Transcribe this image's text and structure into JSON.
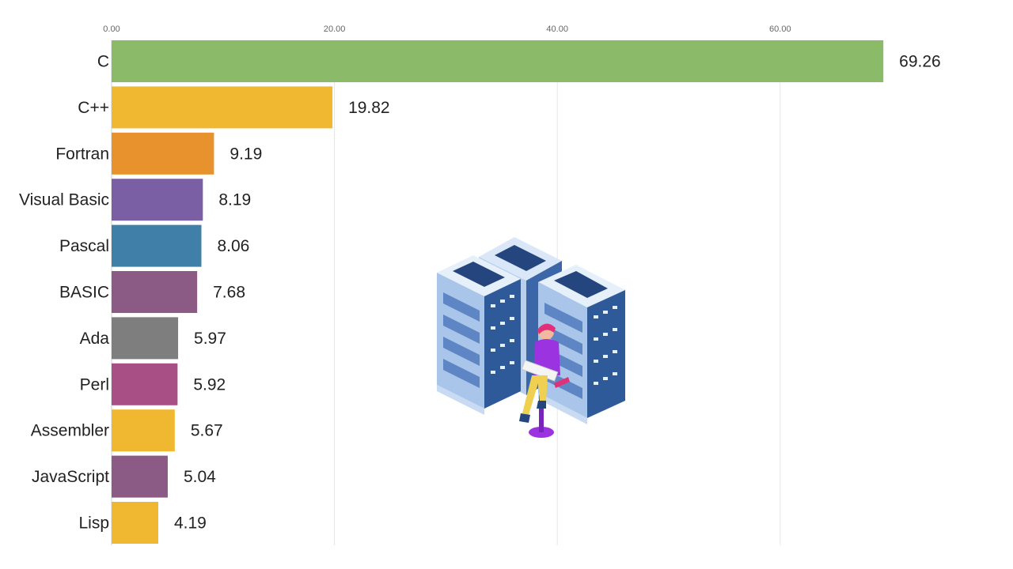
{
  "chart_data": {
    "type": "bar",
    "orientation": "horizontal",
    "categories": [
      "C",
      "C++",
      "Fortran",
      "Visual Basic",
      "Pascal",
      "BASIC",
      "Ada",
      "Perl",
      "Assembler",
      "JavaScript",
      "Lisp"
    ],
    "values": [
      69.26,
      19.82,
      9.19,
      8.19,
      8.06,
      7.68,
      5.97,
      5.92,
      5.67,
      5.04,
      4.19
    ],
    "value_labels": [
      "69.26",
      "19.82",
      "9.19",
      "8.19",
      "8.06",
      "7.68",
      "5.97",
      "5.92",
      "5.67",
      "5.04",
      "4.19"
    ],
    "colors": [
      "#8bbb68",
      "#f0b830",
      "#e8922e",
      "#7a5fa4",
      "#3f7fa8",
      "#8b5a85",
      "#7e7e7e",
      "#a84f85",
      "#f0b830",
      "#8b5a85",
      "#f0b830"
    ],
    "x_ticks": [
      0,
      20,
      40,
      60
    ],
    "x_tick_labels": [
      "0.00",
      "20.00",
      "40.00",
      "60.00"
    ],
    "xlim": [
      0,
      80
    ],
    "axis_position": "top",
    "grid": true,
    "title": "",
    "xlabel": "",
    "ylabel": ""
  },
  "illustration": {
    "name": "server-racks-with-developer",
    "colors": {
      "rack_light": "#e6f0fb",
      "rack_mid": "#a9c6ea",
      "rack_dark": "#24457d",
      "person_shirt": "#9b34e0",
      "person_pants": "#f0d050",
      "person_hair": "#e0307a"
    }
  }
}
